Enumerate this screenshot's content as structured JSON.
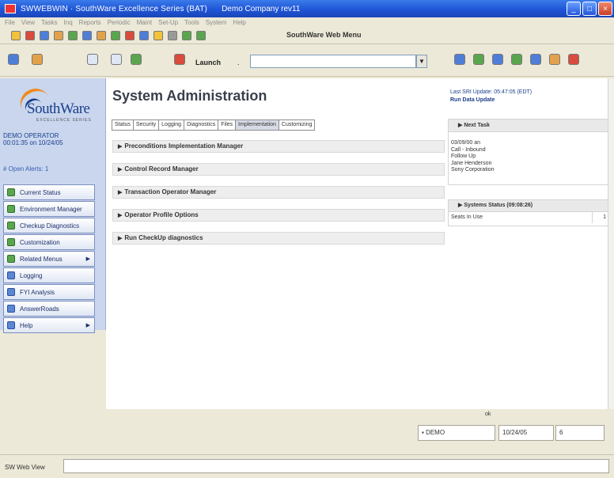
{
  "window": {
    "app_title": "SWWEBWIN · SouthWare Excellence Series (BAT)",
    "company": "Demo Company rev11",
    "colors": {
      "titlebar": "#1f55d6",
      "sidebar": "#c9d6ee",
      "brand_blue": "#1b3f8c",
      "brand_orange": "#f08a1c"
    }
  },
  "menu": {
    "items": [
      "File",
      "View",
      "Tasks",
      "Inq",
      "Reports",
      "Periodic",
      "Maint",
      "Set-Up",
      "Tools",
      "System",
      "Help"
    ]
  },
  "toolbar1": {
    "title": "SouthWare Web Menu"
  },
  "toolbar2": {
    "launch_label": "Launch",
    "launch_dot": ".",
    "launch_value": ""
  },
  "sidebar": {
    "logo_text": "SouthWare",
    "logo_tag": "EXCELLENCE SERIES",
    "operator": "DEMO OPERATOR",
    "login_time": "00:01:35 on 10/24/05",
    "open_alerts": "# Open Alerts: 1",
    "nav": [
      {
        "label": "Current Status",
        "icon": "status-icon"
      },
      {
        "label": "Environment Manager",
        "icon": "environment-icon"
      },
      {
        "label": "Checkup Diagnostics",
        "icon": "diagnostics-icon"
      },
      {
        "label": "Customization",
        "icon": "customization-icon"
      },
      {
        "label": "Related Menus",
        "icon": "menus-icon"
      },
      {
        "label": "Logging",
        "icon": "logging-icon"
      },
      {
        "label": "FYI Analysis",
        "icon": "analysis-icon"
      },
      {
        "label": "AnswerRoads",
        "icon": "answerroads-icon"
      },
      {
        "label": "Help",
        "icon": "help-icon"
      }
    ]
  },
  "main": {
    "title": "System Administration",
    "tabs": [
      "Status",
      "Security",
      "Logging",
      "Diagnostics",
      "Files",
      "Implementation",
      "Customizing"
    ],
    "active_tab": "Implementation",
    "sections": [
      "Preconditions Implementation Manager",
      "Control Record Manager",
      "Transaction Operator Manager",
      "Operator Profile Options",
      "Run CheckUp diagnostics"
    ]
  },
  "right_panel": {
    "last_update": "Last SRI Update: 05:47:05 (EDT)",
    "run_update": "Run Data Update",
    "next_task": {
      "header": "Next Task",
      "lines": [
        "03/09/00 an",
        "Call - Inbound",
        "Follow Up",
        "Jane Henderson",
        "Sony Corporation"
      ]
    },
    "systems_status": {
      "header": "Systems Status (09:08:26)",
      "rows": [
        {
          "label": "Seats In Use",
          "value": "1"
        }
      ]
    }
  },
  "status": {
    "indicator": "ok",
    "user": "DEMO",
    "date": "10/24/05",
    "extra": "6"
  },
  "bottom": {
    "label": "SW Web View"
  }
}
